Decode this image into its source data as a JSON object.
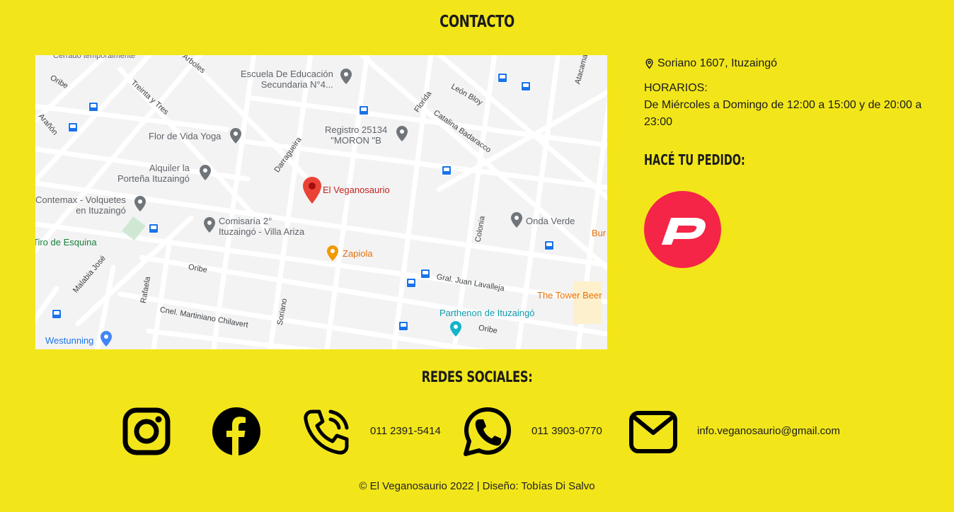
{
  "contact_title": "CONTACTO",
  "address": "Soriano 1607, Ituzaingó",
  "hours_label": "HORARIOS:",
  "hours_text": "De Miércoles a Domingo de 12:00 a 15:00 y de 20:00 a 23:00",
  "order_title": "HACÉ TU PEDIDO:",
  "social_title": "REDES SOCIALES:",
  "phone_1": "011 2391-5414",
  "phone_2": "011 3903-0770",
  "email": "info.veganosaurio@gmail.com",
  "footer": "© El Veganosaurio 2022 | Diseño: Tobías Di Salvo",
  "map": {
    "main_place": "El Veganosaurio",
    "places": {
      "escuela": "Escuela De Educación\nSecundaria N°4...",
      "registro": "Registro 25134\n\"MORON \"B",
      "flor_de_vida": "Flor de Vida Yoga",
      "alquiler": "Alquiler la\nPorteña Ituzaingó",
      "contemax": "Contemax - Volquetes\nen Ituzaingó",
      "comisaria": "Comisaría 2°\nItuzaingó - Villa Ariza",
      "zapiola": "Zapiola",
      "onda_verde": "Onda Verde",
      "tower_beer": "The Tower Beer",
      "parthenon": "Parthenon de Ituzaingó",
      "westunning": "Westunning",
      "tiro": "Tiro de Esquina",
      "cerrado": "Cerrado temporalmente",
      "bur": "Bur"
    },
    "streets": {
      "oribe_top": "Oribe",
      "arboles": "Árboles",
      "treinta_y_tres": "Treinta y Tres",
      "aranon": "Arañón",
      "darragueira": "Darragueira",
      "florida": "Florida",
      "leon_bloy": "León Bloy",
      "catalina": "Catalina Badaracco",
      "atacama": "Atacama",
      "colonia": "Colonia",
      "oribe_mid": "Oribe",
      "juan_lavalleja": "Gral. Juan Lavalleja",
      "malabia": "Malabia José",
      "rafaela": "Rafaela",
      "chilavert": "Cnel. Martiniano Chilavert",
      "soriano": "Soriano",
      "oribe_bottom": "Oribe"
    }
  },
  "colors": {
    "background": "#f2e61a",
    "pedidos": "#f42547",
    "map_red_pin": "#ea4335",
    "map_orange": "#e8710a",
    "map_teal": "#12b5cb"
  },
  "icons": [
    "location-pin-icon",
    "pedidosya-icon",
    "instagram-icon",
    "facebook-icon",
    "phone-icon",
    "whatsapp-icon",
    "mail-icon"
  ]
}
